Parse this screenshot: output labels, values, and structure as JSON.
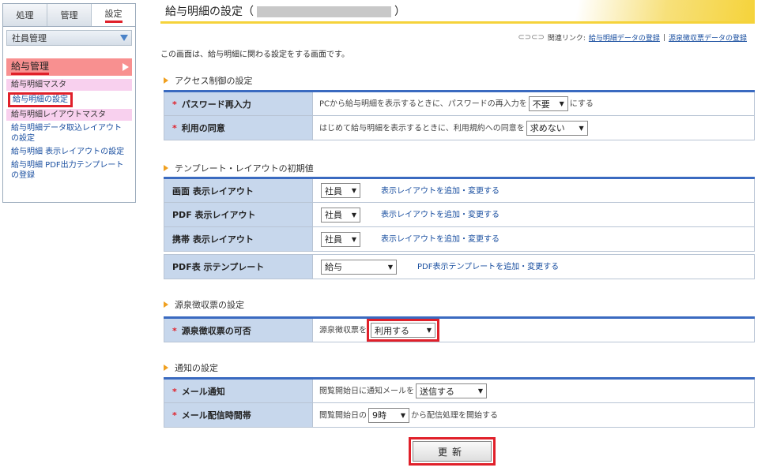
{
  "tabs": [
    "処理",
    "管理",
    "設定"
  ],
  "sidebar": {
    "employee_section": "社員管理",
    "kyuyo_section": "給与管理",
    "items": [
      "給与明細マスタ",
      "給与明細の設定",
      "給与明細レイアウトマスタ",
      "給与明細データ取込レイアウトの設定",
      "給与明細 表示レイアウトの設定",
      "給与明細 PDF出力テンプレートの登録"
    ]
  },
  "header": {
    "title_prefix": "給与明細の設定（",
    "title_suffix": "）",
    "related_label": "関連リンク:",
    "related_link1": "給与明細データの登録",
    "separator": "|",
    "related_link2": "源泉徴収票データの登録"
  },
  "intro": "この画面は、給与明細に関わる設定をする画面です。",
  "access": {
    "heading": "アクセス制御の設定",
    "required_mark": "*",
    "pw_label": "パスワード再入力",
    "pw_text_before": "PCから給与明細を表示するときに、パスワードの再入力を",
    "pw_value": "不要",
    "pw_text_after": "にする",
    "consent_label": "利用の同意",
    "consent_text": "はじめて給与明細を表示するときに、利用規約への同意を",
    "consent_value": "求めない"
  },
  "template": {
    "heading": "テンプレート・レイアウトの初期値",
    "rows": [
      {
        "label": "画面 表示レイアウト",
        "value": "社員",
        "link": "表示レイアウトを追加・変更する"
      },
      {
        "label": "PDF 表示レイアウト",
        "value": "社員",
        "link": "表示レイアウトを追加・変更する"
      },
      {
        "label": "携帯 表示レイアウト",
        "value": "社員",
        "link": "表示レイアウトを追加・変更する"
      }
    ],
    "pdf_label": "PDF表 示テンプレート",
    "pdf_value": "給与",
    "pdf_link": "PDF表示テンプレートを追加・変更する"
  },
  "gensen": {
    "heading": "源泉徴収票の設定",
    "label": "源泉徴収票の可否",
    "text": "源泉徴収票を",
    "value": "利用する"
  },
  "notify": {
    "heading": "通知の設定",
    "mail_label": "メール通知",
    "mail_text": "閲覧開始日に通知メールを",
    "mail_value": "送信する",
    "time_label": "メール配信時間帯",
    "time_text_before": "閲覧開始日の",
    "time_value": "9時",
    "time_text_after": "から配信処理を開始する"
  },
  "update_button": "更新"
}
